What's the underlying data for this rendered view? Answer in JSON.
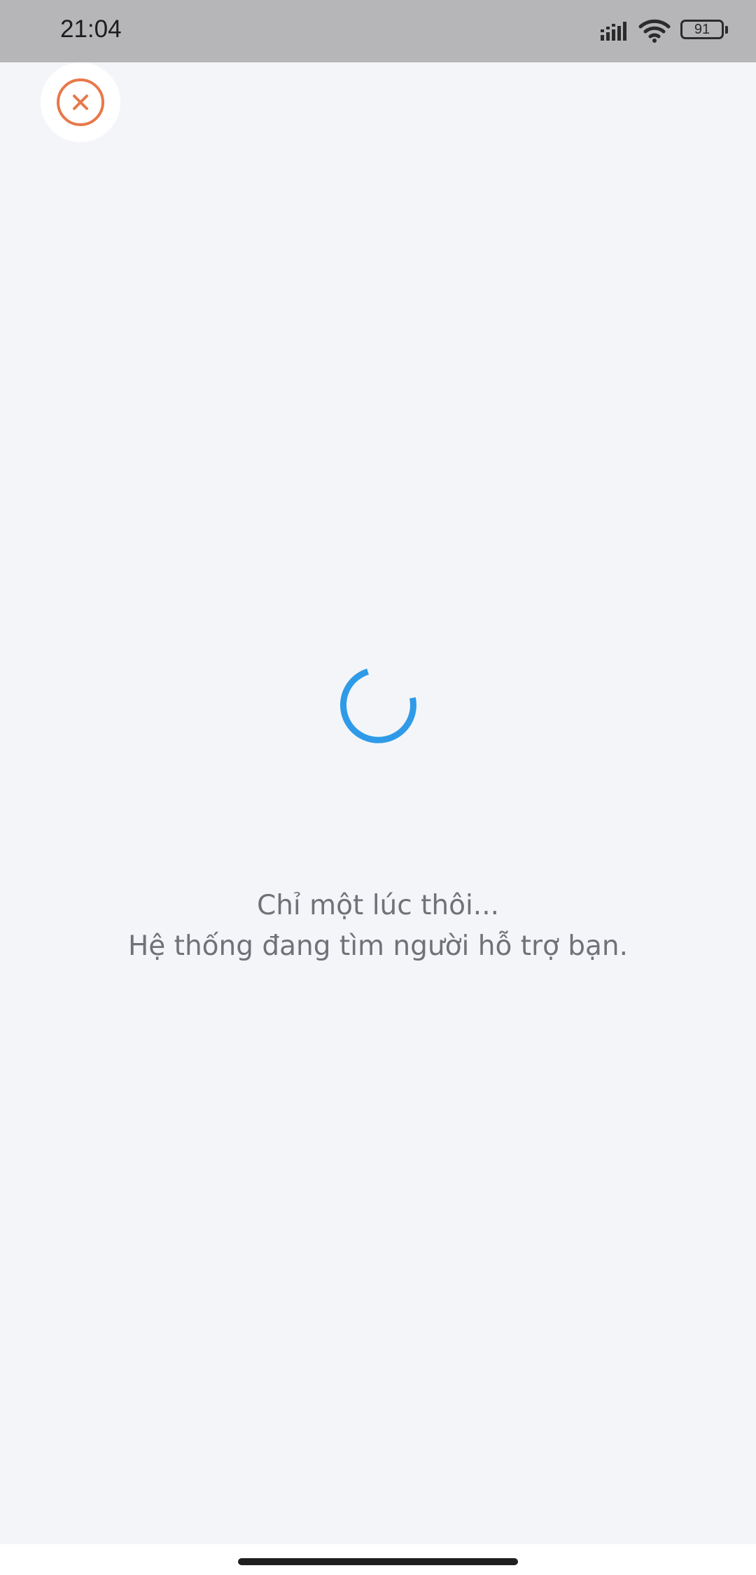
{
  "status_bar": {
    "time": "21:04",
    "battery_level": "91",
    "icons": [
      "signal-icon",
      "wifi-icon",
      "battery-icon"
    ]
  },
  "close_button": {
    "icon": "close-icon",
    "color": "#e8784a"
  },
  "loading": {
    "icon": "loading-spinner",
    "color": "#2f9be8",
    "line1": "Chỉ một lúc thôi...",
    "line2": "Hệ thống đang tìm người hỗ trợ bạn."
  },
  "theme": {
    "background": "#f4f5f9",
    "status_bar_background": "#b6b6b8",
    "text_color": "#707277"
  }
}
